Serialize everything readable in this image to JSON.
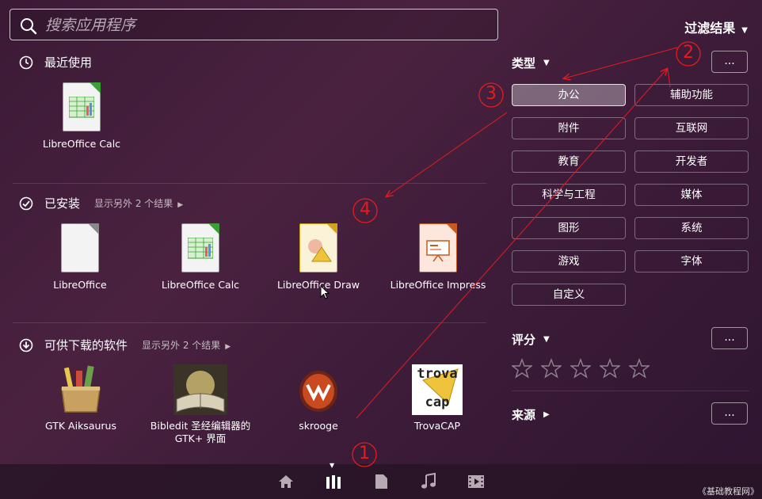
{
  "search": {
    "placeholder": "搜索应用程序"
  },
  "filter": {
    "title": "过滤结果",
    "type_label": "类型",
    "categories": [
      "办公",
      "辅助功能",
      "附件",
      "互联网",
      "教育",
      "开发者",
      "科学与工程",
      "媒体",
      "图形",
      "系统",
      "游戏",
      "字体",
      "自定义"
    ],
    "active_category": "办公",
    "rating_label": "评分",
    "source_label": "来源",
    "more_label": "..."
  },
  "sections": {
    "recent": {
      "title": "最近使用",
      "apps": [
        {
          "label": "LibreOffice Calc",
          "icon": "spreadsheet-icon"
        }
      ]
    },
    "installed": {
      "title": "已安装",
      "more": "显示另外 2 个结果",
      "apps": [
        {
          "label": "LibreOffice",
          "icon": "libreoffice-icon"
        },
        {
          "label": "LibreOffice Calc",
          "icon": "spreadsheet-icon"
        },
        {
          "label": "LibreOffice Draw",
          "icon": "drawing-icon"
        },
        {
          "label": "LibreOffice Impress",
          "icon": "presentation-icon"
        }
      ]
    },
    "downloadable": {
      "title": "可供下载的软件",
      "more": "显示另外 2 个结果",
      "apps": [
        {
          "label": "GTK Aiksaurus",
          "icon": "thesaurus-icon"
        },
        {
          "label": "Bibledit 圣经编辑器的 GTK+ 界面",
          "icon": "bible-icon"
        },
        {
          "label": "skrooge",
          "icon": "skrooge-icon"
        },
        {
          "label": "TrovaCAP",
          "icon": "trovacap-icon"
        }
      ]
    }
  },
  "trovacap_text": {
    "line1": "trova",
    "line2": "cap"
  },
  "annotations": [
    "1",
    "2",
    "3",
    "4"
  ],
  "watermark": "《基础教程网》",
  "colors": {
    "annotation": "#e21d1d",
    "calc_corner": "#3aa035",
    "draw_corner": "#d4a21a",
    "impress_corner": "#c85a1e"
  }
}
